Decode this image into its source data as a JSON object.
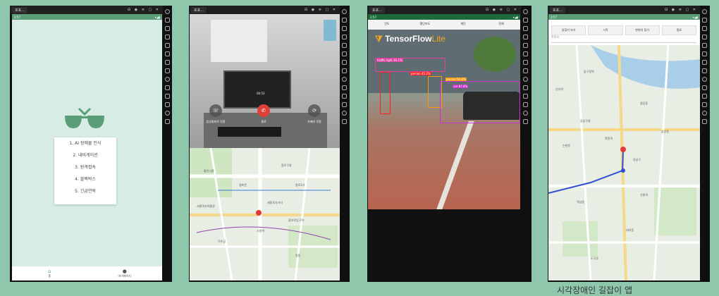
{
  "window": {
    "tab_title": "포포...",
    "toolbar_icons": "⊟ ◉ ≡ ▢ ✕",
    "status_battery": "▾◢▮",
    "status_time": "2:57"
  },
  "sidebar_icons": [
    "settings-icon",
    "keyboard-icon",
    "volume-up-icon",
    "volume-down-icon",
    "fullscreen-icon",
    "screenshot-icon",
    "camera-icon",
    "scissors-icon",
    "rotate-icon",
    "apk-icon",
    "shake-icon",
    "folder-icon",
    "location-icon",
    "more-icon"
  ],
  "screen1": {
    "menu_items": [
      "1. AI 장애물 인식",
      "2. 내비게이션",
      "3. 원격접속",
      "4. 블랙박스",
      "5. 긴급연락"
    ],
    "nav": [
      {
        "label": "홈",
        "icon": "home-icon"
      },
      {
        "label": "마이페이지",
        "icon": "person-icon"
      }
    ],
    "colors": {
      "bg": "#d6ece4",
      "accent": "#5a9e77"
    }
  },
  "screen2": {
    "call_time": "00:53",
    "buttons": [
      {
        "label": "음성통화로 전환",
        "icon": "phone-icon"
      },
      {
        "label": "종료",
        "icon": "end-call-icon"
      },
      {
        "label": "카메라 전환",
        "icon": "switch-camera-icon"
      }
    ],
    "map_labels": [
      "종로구청",
      "통인시장",
      "세종로사거리",
      "광화문",
      "서울역사박물관",
      "종로1가",
      "시청역",
      "덕수궁",
      "을지로입구역",
      "명동"
    ]
  },
  "screen3": {
    "tabs": [
      "인도",
      "횡단보도",
      "계단",
      "전체"
    ],
    "logo_main": "TensorFlow",
    "logo_lite": "Lite",
    "detections": [
      {
        "label": "traffic light 46.1%",
        "color": "#e040a0"
      },
      {
        "label": "person 45.2%",
        "color": "#ff2222"
      },
      {
        "label": "person 56.8%",
        "color": "#ff9900"
      },
      {
        "label": "car 87.0%",
        "color": "#cc33cc"
      }
    ]
  },
  "screen4": {
    "buttons": [
      "길찾기 보기",
      "시작",
      "현위치 찾기",
      "종료"
    ],
    "search_placeholder": "목적지",
    "map_labels": [
      "강남구청",
      "압구정역",
      "청담동",
      "논현동",
      "신사역",
      "학동역",
      "강남구",
      "삼성동",
      "역삼동",
      "선릉역",
      "대치동",
      "도곡동"
    ],
    "route_color": "#2f4fd4"
  },
  "caption": "시각장애인 길잡이 앱"
}
